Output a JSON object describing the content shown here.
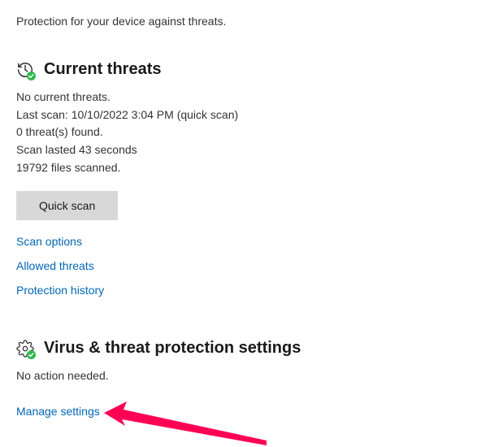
{
  "header": {
    "subtitle": "Protection for your device against threats."
  },
  "threats": {
    "title": "Current threats",
    "status": "No current threats.",
    "last_scan": "Last scan: 10/10/2022 3:04 PM (quick scan)",
    "found": "0 threat(s) found.",
    "duration": "Scan lasted 43 seconds",
    "files": "19792 files scanned.",
    "quick_scan_label": "Quick scan",
    "links": {
      "scan_options": "Scan options",
      "allowed_threats": "Allowed threats",
      "protection_history": "Protection history"
    }
  },
  "settings": {
    "title": "Virus & threat protection settings",
    "status": "No action needed.",
    "manage_link": "Manage settings"
  }
}
